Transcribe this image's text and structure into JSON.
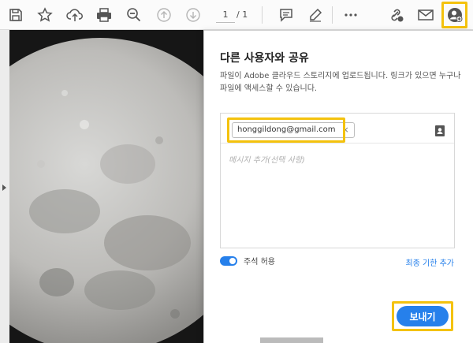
{
  "toolbar": {
    "icons": [
      "save-icon",
      "bookmark-star-icon",
      "upload-cloud-icon",
      "print-icon",
      "zoom-out-icon",
      "page-up-icon",
      "page-down-icon",
      "comment-icon",
      "highlight-pen-icon",
      "more-icon",
      "share-link-icon",
      "email-icon",
      "add-user-icon"
    ],
    "page_current": "1",
    "page_total": "/ 1",
    "highlight_color": "#f4c20d"
  },
  "share_panel": {
    "title": "다른 사용자와 공유",
    "description": "파일이 Adobe 클라우드 스토리지에 업로드됩니다. 링크가 있으면 누구나 파일에 액세스할 수 있습니다.",
    "recipient_email": "honggildong@gmail.com",
    "chip_remove": "×",
    "message_placeholder": "메시지 추가(선택 사항)",
    "allow_comments_label": "주석 허용",
    "allow_comments_on": true,
    "deadline_link": "최종 기한 추가",
    "send_label": "보내기",
    "accent_color": "#2680eb"
  }
}
